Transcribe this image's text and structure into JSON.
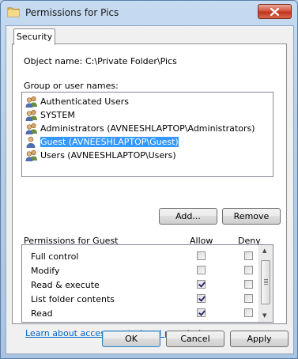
{
  "window": {
    "title": "Permissions for Pics"
  },
  "tabs": [
    {
      "label": "Security"
    }
  ],
  "object": {
    "label": "Object name:",
    "value": "C:\\Private Folder\\Pics"
  },
  "groups": {
    "label": "Group or user names:",
    "items": [
      {
        "label": "Authenticated Users",
        "icon": "users-icon",
        "selected": false
      },
      {
        "label": "SYSTEM",
        "icon": "users-icon",
        "selected": false
      },
      {
        "label": "Administrators (AVNEESHLAPTOP\\Administrators)",
        "icon": "users-icon",
        "selected": false
      },
      {
        "label": "Guest (AVNEESHLAPTOP\\Guest)",
        "icon": "user-icon",
        "selected": true
      },
      {
        "label": "Users (AVNEESHLAPTOP\\Users)",
        "icon": "users-icon",
        "selected": false
      }
    ]
  },
  "buttons": {
    "add": "Add...",
    "remove": "Remove",
    "ok": "OK",
    "cancel": "Cancel",
    "apply": "Apply"
  },
  "permissions": {
    "label": "Permissions for Guest",
    "allow_header": "Allow",
    "deny_header": "Deny",
    "rows": [
      {
        "name": "Full control",
        "allow": false,
        "deny": false
      },
      {
        "name": "Modify",
        "allow": false,
        "deny": false
      },
      {
        "name": "Read & execute",
        "allow": true,
        "deny": false
      },
      {
        "name": "List folder contents",
        "allow": true,
        "deny": false
      },
      {
        "name": "Read",
        "allow": true,
        "deny": false
      }
    ]
  },
  "link": "Learn about access control and permissions",
  "colors": {
    "selection": "#3399ff",
    "link": "#0066cc",
    "close_button": "#c1341e"
  }
}
